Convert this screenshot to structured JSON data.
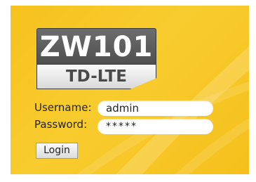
{
  "logo": {
    "model": "ZW101",
    "technology": "TD-LTE"
  },
  "form": {
    "username_label": "Username:",
    "username_value": "admin",
    "password_label": "Password:",
    "password_value": "*****",
    "login_label": "Login"
  },
  "colors": {
    "panel_background": "#f6c21e",
    "logo_dark": "#5a5a5a",
    "logo_light": "#f0f0f0"
  }
}
